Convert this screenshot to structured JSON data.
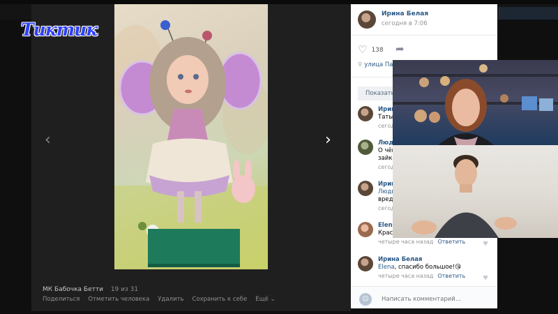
{
  "watermark": {
    "text": "Тиктик"
  },
  "viewer": {
    "prev_label": "‹",
    "next_label": "›",
    "photo_title": "МК Бабочка Бетти",
    "counter": "19 из 31",
    "actions": [
      "Поделиться",
      "Отметить человека",
      "Удалить",
      "Сохранить к себе",
      "Ещё ⌄"
    ]
  },
  "post": {
    "author": "Ирина Белая",
    "time": "сегодня в 7:06",
    "likes": "138",
    "location": "улица Па"
  },
  "show_previous": "Показать",
  "comments": [
    {
      "name": "Ирина",
      "text": "Таты",
      "meta": "сегод"
    },
    {
      "name": "Людм",
      "text": "О чём",
      "text2": "зайка",
      "meta": "сегод"
    },
    {
      "name": "Ирина",
      "mention": "Людм",
      "text2": "вреди",
      "meta": "сегод"
    },
    {
      "name": "Elena",
      "text": "Крас",
      "meta": "четыре часа назад",
      "reply": "Ответить"
    },
    {
      "name": "Ирина Белая",
      "mention": "Elena",
      "text": ", спасибо большое!😘",
      "meta": "четыре часа назад",
      "reply": "Ответить"
    }
  ],
  "input": {
    "placeholder": "Написать комментарий..."
  },
  "icons": {
    "like": "heart-outline-icon",
    "share": "share-arrow-icon",
    "location": "map-pin-icon"
  },
  "colors": {
    "link": "#2a5885",
    "watermark": "#2f41ff",
    "viewer_bg": "#1f1f20"
  }
}
